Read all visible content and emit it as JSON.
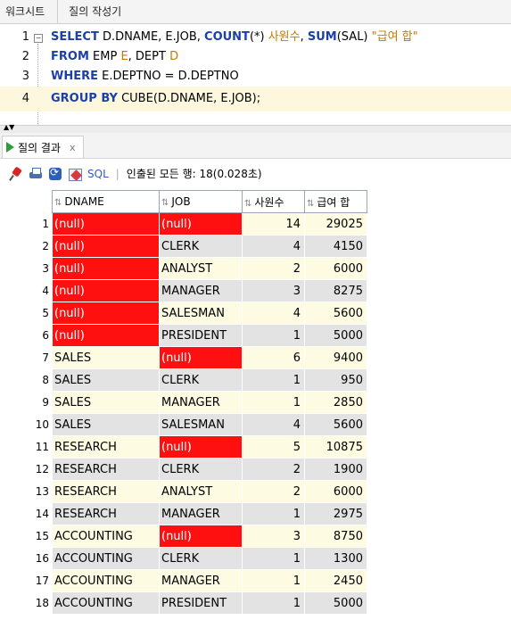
{
  "tabs": {
    "worksheet": "워크시트",
    "query_builder": "질의 작성기"
  },
  "editor": {
    "line_numbers": [
      "1",
      "2",
      "3",
      "4"
    ],
    "line1": {
      "select": "SELECT",
      "cols": " D.DNAME, E.JOB, ",
      "count": "COUNT",
      "count_arg": "(*) ",
      "alias1": "사원수",
      "comma": ", ",
      "sum": "SUM",
      "sum_arg": "(SAL) ",
      "alias2": "\"급여 합\""
    },
    "line2": {
      "from": "FROM",
      "emp": " EMP ",
      "e": "E",
      "dept": ", DEPT ",
      "d": "D"
    },
    "line3": {
      "where": "WHERE",
      "cond": " E.DEPTNO = D.DEPTNO"
    },
    "line4": {
      "group_by": "GROUP BY",
      "cube": " CUBE",
      "args": "(D.DNAME, E.JOB);"
    }
  },
  "result_tab": {
    "label": "질의 결과",
    "close": "x"
  },
  "toolbar": {
    "sql_label": "SQL",
    "separator": "|",
    "status": "인출된 모든 행: 18(0.028초)"
  },
  "grid": {
    "columns": [
      "DNAME",
      "JOB",
      "사원수",
      "급여 합"
    ],
    "rows": [
      {
        "n": "1",
        "dname": "(null)",
        "job": "(null)",
        "cnt": "14",
        "sal": "29025"
      },
      {
        "n": "2",
        "dname": "(null)",
        "job": "CLERK",
        "cnt": "4",
        "sal": "4150"
      },
      {
        "n": "3",
        "dname": "(null)",
        "job": "ANALYST",
        "cnt": "2",
        "sal": "6000"
      },
      {
        "n": "4",
        "dname": "(null)",
        "job": "MANAGER",
        "cnt": "3",
        "sal": "8275"
      },
      {
        "n": "5",
        "dname": "(null)",
        "job": "SALESMAN",
        "cnt": "4",
        "sal": "5600"
      },
      {
        "n": "6",
        "dname": "(null)",
        "job": "PRESIDENT",
        "cnt": "1",
        "sal": "5000"
      },
      {
        "n": "7",
        "dname": "SALES",
        "job": "(null)",
        "cnt": "6",
        "sal": "9400"
      },
      {
        "n": "8",
        "dname": "SALES",
        "job": "CLERK",
        "cnt": "1",
        "sal": "950"
      },
      {
        "n": "9",
        "dname": "SALES",
        "job": "MANAGER",
        "cnt": "1",
        "sal": "2850"
      },
      {
        "n": "10",
        "dname": "SALES",
        "job": "SALESMAN",
        "cnt": "4",
        "sal": "5600"
      },
      {
        "n": "11",
        "dname": "RESEARCH",
        "job": "(null)",
        "cnt": "5",
        "sal": "10875"
      },
      {
        "n": "12",
        "dname": "RESEARCH",
        "job": "CLERK",
        "cnt": "2",
        "sal": "1900"
      },
      {
        "n": "13",
        "dname": "RESEARCH",
        "job": "ANALYST",
        "cnt": "2",
        "sal": "6000"
      },
      {
        "n": "14",
        "dname": "RESEARCH",
        "job": "MANAGER",
        "cnt": "1",
        "sal": "2975"
      },
      {
        "n": "15",
        "dname": "ACCOUNTING",
        "job": "(null)",
        "cnt": "3",
        "sal": "8750"
      },
      {
        "n": "16",
        "dname": "ACCOUNTING",
        "job": "CLERK",
        "cnt": "1",
        "sal": "1300"
      },
      {
        "n": "17",
        "dname": "ACCOUNTING",
        "job": "MANAGER",
        "cnt": "1",
        "sal": "2450"
      },
      {
        "n": "18",
        "dname": "ACCOUNTING",
        "job": "PRESIDENT",
        "cnt": "1",
        "sal": "5000"
      }
    ]
  },
  "colors": {
    "null_cell": "#ff1010",
    "keyword": "#1c3fa8",
    "alias": "#c47a00",
    "row_odd": "#fdfbe1",
    "row_even": "#e4e3e3"
  }
}
